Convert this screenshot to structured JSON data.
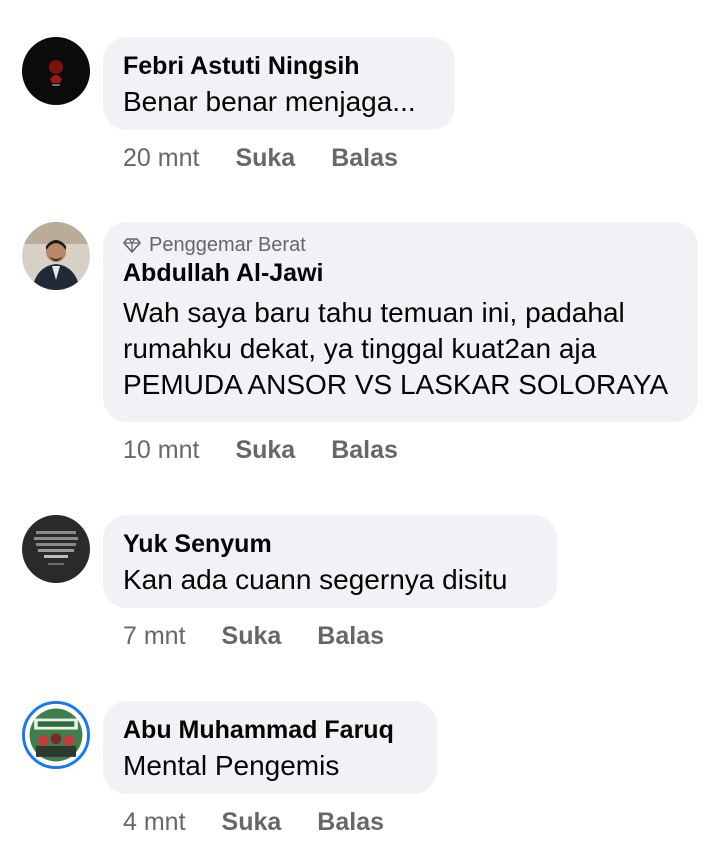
{
  "comments": [
    {
      "author": "Febri Astuti Ningsih",
      "text_lines": [
        "Benar benar menjaga..."
      ],
      "time": "20 mnt",
      "like_label": "Suka",
      "reply_label": "Balas",
      "badge": ""
    },
    {
      "author": "Abdullah Al-Jawi",
      "badge": "Penggemar Berat",
      "badge_icon": "diamond-icon",
      "text_lines": [
        "Wah saya baru tahu temuan ini, padahal",
        "rumahku dekat, ya tinggal kuat2an aja",
        "PEMUDA ANSOR VS LASKAR SOLORAYA"
      ],
      "time": "10 mnt",
      "like_label": "Suka",
      "reply_label": "Balas"
    },
    {
      "author": "Yuk Senyum",
      "text_lines": [
        "Kan ada cuann segernya disitu"
      ],
      "time": "7 mnt",
      "like_label": "Suka",
      "reply_label": "Balas",
      "badge": ""
    },
    {
      "author": "Abu Muhammad Faruq",
      "text_lines": [
        "Mental Pengemis"
      ],
      "time": "4 mnt",
      "like_label": "Suka",
      "reply_label": "Balas",
      "badge": ""
    }
  ],
  "colors": {
    "bubble_bg": "#f0f2f5",
    "meta_text": "#65676b",
    "primary_text": "#050505",
    "story_ring": "#1877f2"
  }
}
